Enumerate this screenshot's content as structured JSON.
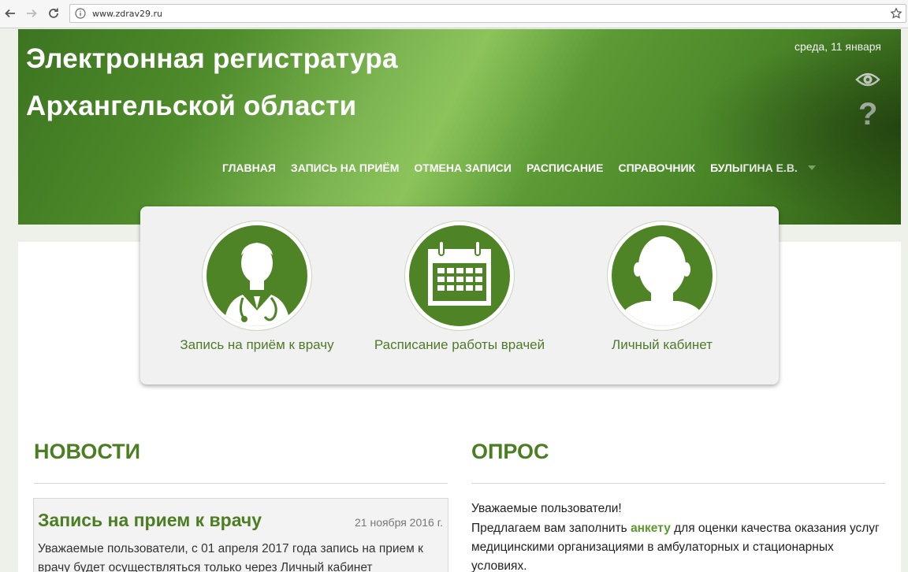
{
  "browser": {
    "url": "www.zdrav29.ru",
    "icons": {
      "back": "back-arrow-icon",
      "forward": "forward-arrow-icon",
      "reload": "reload-icon",
      "info": "info-icon",
      "bookmark": "star-icon"
    }
  },
  "header": {
    "title_line1": "Электронная регистратура",
    "title_line2": "Архангельской области",
    "date": "среда, 11 января",
    "accessibility_icon": "eye-icon",
    "help_label": "?",
    "nav": [
      {
        "label": "ГЛАВНАЯ"
      },
      {
        "label": "ЗАПИСЬ НА ПРИЁМ"
      },
      {
        "label": "ОТМЕНА ЗАПИСИ"
      },
      {
        "label": "РАСПИСАНИЕ"
      },
      {
        "label": "СПРАВОЧНИК"
      },
      {
        "label": "БУЛЫГИНА Е.В."
      }
    ]
  },
  "tiles": [
    {
      "label": "Запись на приём к врачу",
      "icon": "doctor-icon"
    },
    {
      "label": "Расписание работы врачей",
      "icon": "calendar-icon"
    },
    {
      "label": "Личный кабинет",
      "icon": "user-silhouette-icon"
    }
  ],
  "news": {
    "heading": "НОВОСТИ",
    "item": {
      "title": "Запись на прием к врачу",
      "date": "21 ноября 2016 г.",
      "text": "Уважаемые пользователи, с 01 апреля 2017 года запись на прием к врачу будет осуществляться только через Личный кабинет"
    }
  },
  "poll": {
    "heading": "ОПРОС",
    "greeting": "Уважаемые пользователи!",
    "text_before": "Предлагаем вам заполнить ",
    "link": "анкету",
    "text_after": " для оценки качества оказания услуг медицинскими организациями в амбулаторных и стационарных условиях."
  },
  "colors": {
    "brand_green": "#4e8326",
    "heading_green": "#4b7d23",
    "link_green": "#5b9a2d"
  }
}
